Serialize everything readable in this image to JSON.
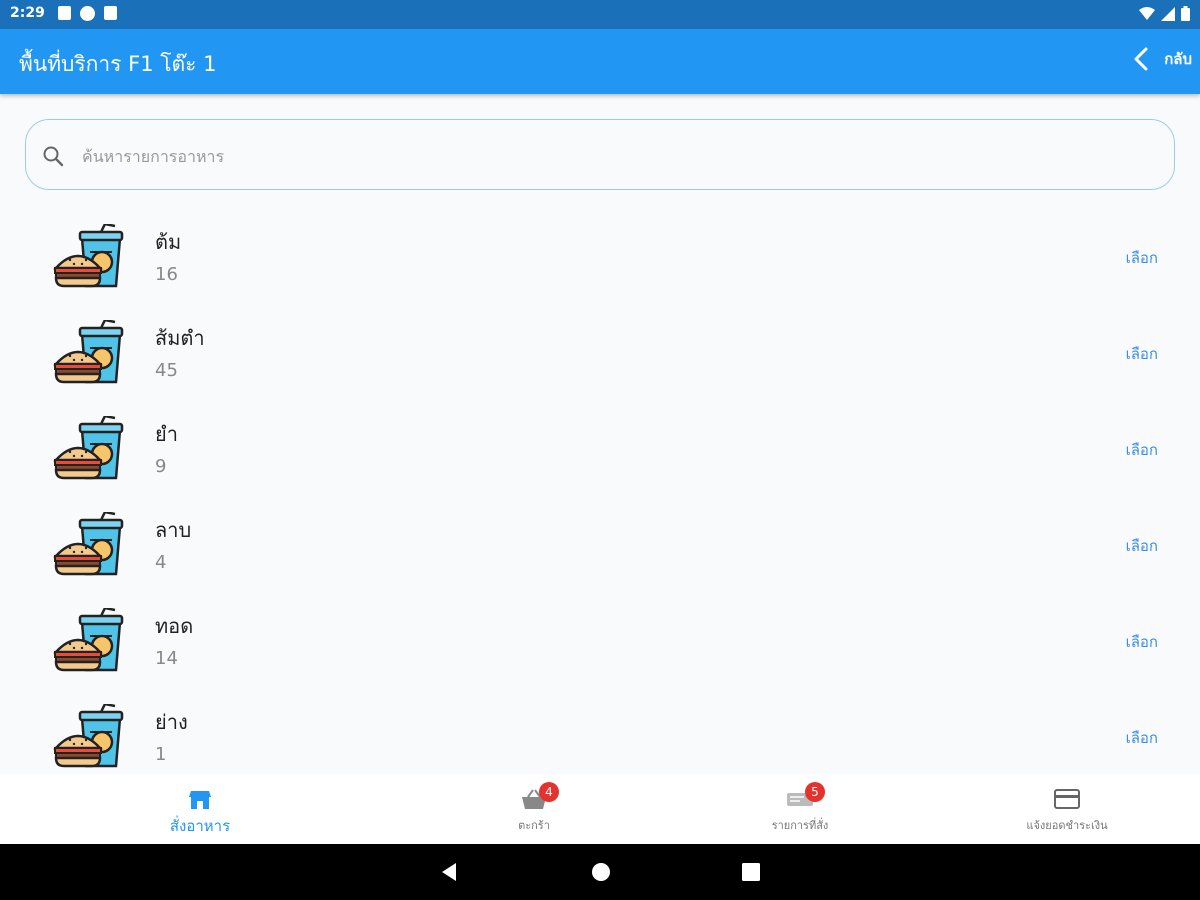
{
  "status_bar": {
    "time": "2:29"
  },
  "app_bar": {
    "title": "พื้นที่บริการ F1 โต๊ะ 1",
    "back_label": "กลับ"
  },
  "search": {
    "placeholder": "ค้นหารายการอาหาร",
    "value": ""
  },
  "categories": [
    {
      "name": "ต้ม",
      "count": "16",
      "action": "เลือก"
    },
    {
      "name": "ส้มตำ",
      "count": "45",
      "action": "เลือก"
    },
    {
      "name": "ยำ",
      "count": "9",
      "action": "เลือก"
    },
    {
      "name": "ลาบ",
      "count": "4",
      "action": "เลือก"
    },
    {
      "name": "ทอด",
      "count": "14",
      "action": "เลือก"
    },
    {
      "name": "ย่าง",
      "count": "1",
      "action": "เลือก"
    }
  ],
  "bottom_nav": [
    {
      "label": "สั่งอาหาร",
      "icon": "store-icon",
      "active": true
    },
    {
      "label": "ตะกร้า",
      "icon": "basket-icon",
      "badge": "4"
    },
    {
      "label": "รายการที่สั่ง",
      "icon": "order-list-icon",
      "badge": "5"
    },
    {
      "label": "แจ้งยอดชำระเงิน",
      "icon": "credit-card-icon"
    }
  ],
  "colors": {
    "status_bar": "#1b71b9",
    "app_bar": "#2196f3",
    "accent": "#2196f3",
    "badge": "#e5322d",
    "background": "#f9fafb"
  }
}
